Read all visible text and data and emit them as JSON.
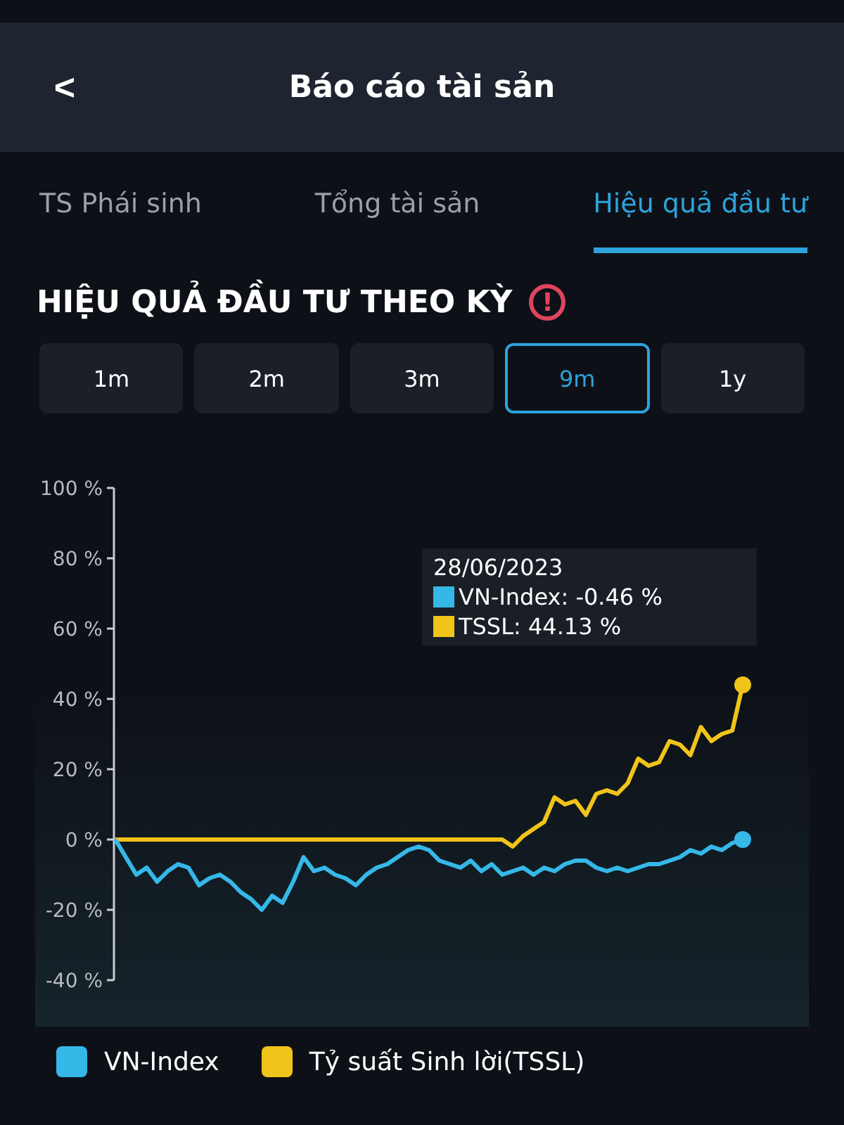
{
  "header": {
    "back_icon": "<",
    "title": "Báo cáo tài sản"
  },
  "tabs": [
    {
      "label": "TS Phái sinh",
      "selected": false
    },
    {
      "label": "Tổng tài sản",
      "selected": false
    },
    {
      "label": "Hiệu quả đầu tư",
      "selected": true
    }
  ],
  "section": {
    "title": "HIỆU QUẢ ĐẦU TƯ THEO KỲ",
    "info_icon": "!"
  },
  "periods": [
    {
      "label": "1m",
      "selected": false
    },
    {
      "label": "2m",
      "selected": false
    },
    {
      "label": "3m",
      "selected": false
    },
    {
      "label": "9m",
      "selected": true
    },
    {
      "label": "1y",
      "selected": false
    }
  ],
  "chart": {
    "chart_data": {
      "type": "line",
      "ylim": [
        -40,
        100
      ],
      "yticks": [
        {
          "value": -40,
          "label": "-40 %"
        },
        {
          "value": -20,
          "label": "-20 %"
        },
        {
          "value": 0,
          "label": "0 %"
        },
        {
          "value": 20,
          "label": "20 %"
        },
        {
          "value": 40,
          "label": "40 %"
        },
        {
          "value": 60,
          "label": "60 %"
        },
        {
          "value": 80,
          "label": "80 %"
        },
        {
          "value": 100,
          "label": "100 %"
        }
      ],
      "series": [
        {
          "name": "VN-Index",
          "color": "#35b8e8",
          "values": [
            0,
            -5,
            -10,
            -8,
            -12,
            -9,
            -7,
            -8,
            -13,
            -11,
            -10,
            -12,
            -15,
            -17,
            -20,
            -16,
            -18,
            -12,
            -5,
            -9,
            -8,
            -10,
            -11,
            -13,
            -10,
            -8,
            -7,
            -5,
            -3,
            -2,
            -3,
            -6,
            -7,
            -8,
            -6,
            -9,
            -7,
            -10,
            -9,
            -8,
            -10,
            -8,
            -9,
            -7,
            -6,
            -6,
            -8,
            -9,
            -8,
            -9,
            -8,
            -7,
            -7,
            -6,
            -5,
            -3,
            -4,
            -2,
            -3,
            -1,
            0
          ]
        },
        {
          "name": "Tỷ suất Sinh lời(TSSL)",
          "color": "#f0c419",
          "values": [
            0,
            0,
            0,
            0,
            0,
            0,
            0,
            0,
            0,
            0,
            0,
            0,
            0,
            0,
            0,
            0,
            0,
            0,
            0,
            0,
            0,
            0,
            0,
            0,
            0,
            0,
            0,
            0,
            0,
            0,
            0,
            0,
            0,
            0,
            0,
            0,
            0,
            0,
            -2,
            1,
            3,
            5,
            12,
            10,
            11,
            7,
            13,
            14,
            13,
            16,
            23,
            21,
            22,
            28,
            27,
            24,
            32,
            28,
            30,
            31,
            44
          ]
        }
      ]
    },
    "tooltip": {
      "date": "28/06/2023",
      "rows": [
        {
          "text": "VN-Index: -0.46 %",
          "color": "#35b8e8"
        },
        {
          "text": "TSSL: 44.13 %",
          "color": "#f0c419"
        }
      ]
    }
  }
}
